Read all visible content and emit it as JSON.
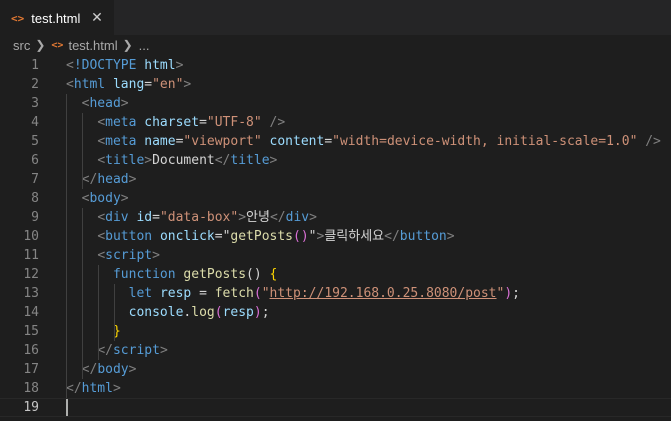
{
  "tab": {
    "icon": "<>",
    "label": "test.html",
    "close": "✕"
  },
  "breadcrumb": {
    "folder": "src",
    "icon": "<>",
    "file": "test.html",
    "more": "..."
  },
  "editor": {
    "current_line": 19,
    "lines": [
      {
        "n": "1",
        "tokens": [
          [
            "p",
            "<"
          ],
          [
            "t",
            "!DOCTYPE"
          ],
          [
            "x",
            " "
          ],
          [
            "a",
            "html"
          ],
          [
            "p",
            ">"
          ]
        ]
      },
      {
        "n": "2",
        "tokens": [
          [
            "p",
            "<"
          ],
          [
            "t",
            "html"
          ],
          [
            "x",
            " "
          ],
          [
            "a",
            "lang"
          ],
          [
            "x",
            "="
          ],
          [
            "s",
            "\"en\""
          ],
          [
            "p",
            ">"
          ]
        ]
      },
      {
        "n": "3",
        "tokens": [
          [
            "x",
            "  "
          ],
          [
            "p",
            "<"
          ],
          [
            "t",
            "head"
          ],
          [
            "p",
            ">"
          ]
        ]
      },
      {
        "n": "4",
        "tokens": [
          [
            "x",
            "    "
          ],
          [
            "p",
            "<"
          ],
          [
            "t",
            "meta"
          ],
          [
            "x",
            " "
          ],
          [
            "a",
            "charset"
          ],
          [
            "x",
            "="
          ],
          [
            "s",
            "\"UTF-8\""
          ],
          [
            "x",
            " "
          ],
          [
            "p",
            "/>"
          ]
        ]
      },
      {
        "n": "5",
        "tokens": [
          [
            "x",
            "    "
          ],
          [
            "p",
            "<"
          ],
          [
            "t",
            "meta"
          ],
          [
            "x",
            " "
          ],
          [
            "a",
            "name"
          ],
          [
            "x",
            "="
          ],
          [
            "s",
            "\"viewport\""
          ],
          [
            "x",
            " "
          ],
          [
            "a",
            "content"
          ],
          [
            "x",
            "="
          ],
          [
            "s",
            "\"width=device-width, initial-scale=1.0\""
          ],
          [
            "x",
            " "
          ],
          [
            "p",
            "/>"
          ]
        ]
      },
      {
        "n": "6",
        "tokens": [
          [
            "x",
            "    "
          ],
          [
            "p",
            "<"
          ],
          [
            "t",
            "title"
          ],
          [
            "p",
            ">"
          ],
          [
            "x",
            "Document"
          ],
          [
            "p",
            "</"
          ],
          [
            "t",
            "title"
          ],
          [
            "p",
            ">"
          ]
        ]
      },
      {
        "n": "7",
        "tokens": [
          [
            "x",
            "  "
          ],
          [
            "p",
            "</"
          ],
          [
            "t",
            "head"
          ],
          [
            "p",
            ">"
          ]
        ]
      },
      {
        "n": "8",
        "tokens": [
          [
            "x",
            "  "
          ],
          [
            "p",
            "<"
          ],
          [
            "t",
            "body"
          ],
          [
            "p",
            ">"
          ]
        ]
      },
      {
        "n": "9",
        "tokens": [
          [
            "x",
            "    "
          ],
          [
            "p",
            "<"
          ],
          [
            "t",
            "div"
          ],
          [
            "x",
            " "
          ],
          [
            "a",
            "id"
          ],
          [
            "x",
            "="
          ],
          [
            "s",
            "\"data-box\""
          ],
          [
            "p",
            ">"
          ],
          [
            "x",
            "안녕"
          ],
          [
            "p",
            "</"
          ],
          [
            "t",
            "div"
          ],
          [
            "p",
            ">"
          ]
        ]
      },
      {
        "n": "10",
        "tokens": [
          [
            "x",
            "    "
          ],
          [
            "p",
            "<"
          ],
          [
            "t",
            "button"
          ],
          [
            "x",
            " "
          ],
          [
            "a",
            "onclick"
          ],
          [
            "x",
            "="
          ],
          [
            "x",
            "\""
          ],
          [
            "f",
            "getPosts"
          ],
          [
            "b1",
            "()"
          ],
          [
            "x",
            "\""
          ],
          [
            "p",
            ">"
          ],
          [
            "x",
            "클릭하세요"
          ],
          [
            "p",
            "</"
          ],
          [
            "t",
            "button"
          ],
          [
            "p",
            ">"
          ]
        ]
      },
      {
        "n": "11",
        "tokens": [
          [
            "x",
            "    "
          ],
          [
            "p",
            "<"
          ],
          [
            "t",
            "script"
          ],
          [
            "p",
            ">"
          ]
        ]
      },
      {
        "n": "12",
        "tokens": [
          [
            "x",
            "      "
          ],
          [
            "k",
            "function"
          ],
          [
            "x",
            " "
          ],
          [
            "f",
            "getPosts"
          ],
          [
            "x",
            "() "
          ],
          [
            "by",
            "{"
          ]
        ]
      },
      {
        "n": "13",
        "tokens": [
          [
            "x",
            "        "
          ],
          [
            "k",
            "let"
          ],
          [
            "x",
            " "
          ],
          [
            "v",
            "resp"
          ],
          [
            "x",
            " = "
          ],
          [
            "f",
            "fetch"
          ],
          [
            "b1",
            "("
          ],
          [
            "s",
            "\""
          ],
          [
            "su",
            "http://192.168.0.25.8080/post"
          ],
          [
            "s",
            "\""
          ],
          [
            "b1",
            ")"
          ],
          [
            "x",
            ";"
          ]
        ]
      },
      {
        "n": "14",
        "tokens": [
          [
            "x",
            "        "
          ],
          [
            "v",
            "console"
          ],
          [
            "x",
            "."
          ],
          [
            "f",
            "log"
          ],
          [
            "b1",
            "("
          ],
          [
            "v",
            "resp"
          ],
          [
            "b1",
            ")"
          ],
          [
            "x",
            ";"
          ]
        ]
      },
      {
        "n": "15",
        "tokens": [
          [
            "x",
            "      "
          ],
          [
            "by",
            "}"
          ]
        ]
      },
      {
        "n": "16",
        "tokens": [
          [
            "x",
            "    "
          ],
          [
            "p",
            "</"
          ],
          [
            "t",
            "script"
          ],
          [
            "p",
            ">"
          ]
        ]
      },
      {
        "n": "17",
        "tokens": [
          [
            "x",
            "  "
          ],
          [
            "p",
            "</"
          ],
          [
            "t",
            "body"
          ],
          [
            "p",
            ">"
          ]
        ]
      },
      {
        "n": "18",
        "tokens": [
          [
            "p",
            "</"
          ],
          [
            "t",
            "html"
          ],
          [
            "p",
            ">"
          ]
        ]
      },
      {
        "n": "19",
        "tokens": []
      }
    ]
  }
}
